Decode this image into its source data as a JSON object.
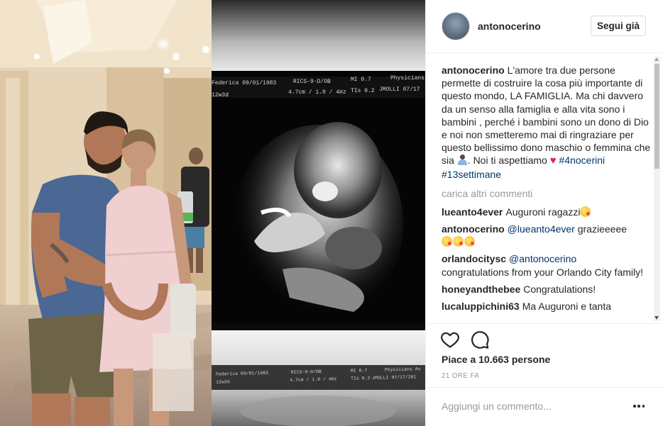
{
  "post": {
    "username": "antonocerino",
    "follow_label": "Segui già",
    "caption": {
      "user": "antonocerino",
      "text_before_emoji": "L'amore tra due persone permette di costruire la cosa più importante di questo mondo, LA FAMIGLIA. Ma chi davvero da un senso alla famiglia e alla vita sono i bambini , perché i bambini sono un dono di Dio e noi non smetteremo mai di ringraziare per questo bellissimo dono maschio o femmina che sia ",
      "text_mid": ". Noi ti aspettiamo ",
      "hashtags": [
        "#4nocerini",
        "#13settimane"
      ],
      "emojis": [
        "person-emoji",
        "heart-emoji"
      ]
    },
    "load_more_label": "carica altri commenti",
    "comments": [
      {
        "user": "lueanto4ever",
        "text": "Auguroni ragazzi",
        "emojis": [
          "kiss-face-emoji"
        ]
      },
      {
        "user": "antonocerino",
        "mention": "@lueanto4ever",
        "text": "grazieeeee",
        "emojis": [
          "kiss-face-emoji",
          "kiss-face-emoji",
          "kiss-face-emoji"
        ]
      },
      {
        "user": "orlandocitysc",
        "mention": "@antonocerino",
        "text": "congratulations from your Orlando City family!"
      },
      {
        "user": "honeyandthebee",
        "text": "Congratulations!"
      },
      {
        "user": "lucaluppichini63",
        "text": "Ma Auguroni e tanta"
      }
    ],
    "likes_text": "Piace a 10.663 persone",
    "timestamp": "21 ORE FA",
    "add_comment_placeholder": "Aggiungi un commento...",
    "icons": [
      "heart-icon",
      "comment-icon",
      "more-options-icon",
      "avatar"
    ]
  },
  "media": {
    "ultrasound_top": {
      "line1": [
        "Federica 09/01/1983",
        "RICS-9-D/OB",
        "MI 0.7",
        "Physicians"
      ],
      "line2": [
        "12w3d",
        "4.7cm / 1.0 / 4Hz",
        "TIs 0.2",
        "JMOLLI 07/17"
      ]
    },
    "ultrasound_bottom": {
      "line1": [
        "Federica 09/01/1983",
        "RICS-9-D/OB",
        "MI 0.7",
        "Physicians As"
      ],
      "line2": [
        "12w3d",
        "4.7cm / 1.0 / 4Hz",
        "TIs 0.2",
        "JMOLLI 07/17/201"
      ]
    }
  },
  "colors": {
    "text": "#262626",
    "muted": "#999999",
    "link": "#003569",
    "border": "#efefef",
    "heart": "#e0245e"
  }
}
